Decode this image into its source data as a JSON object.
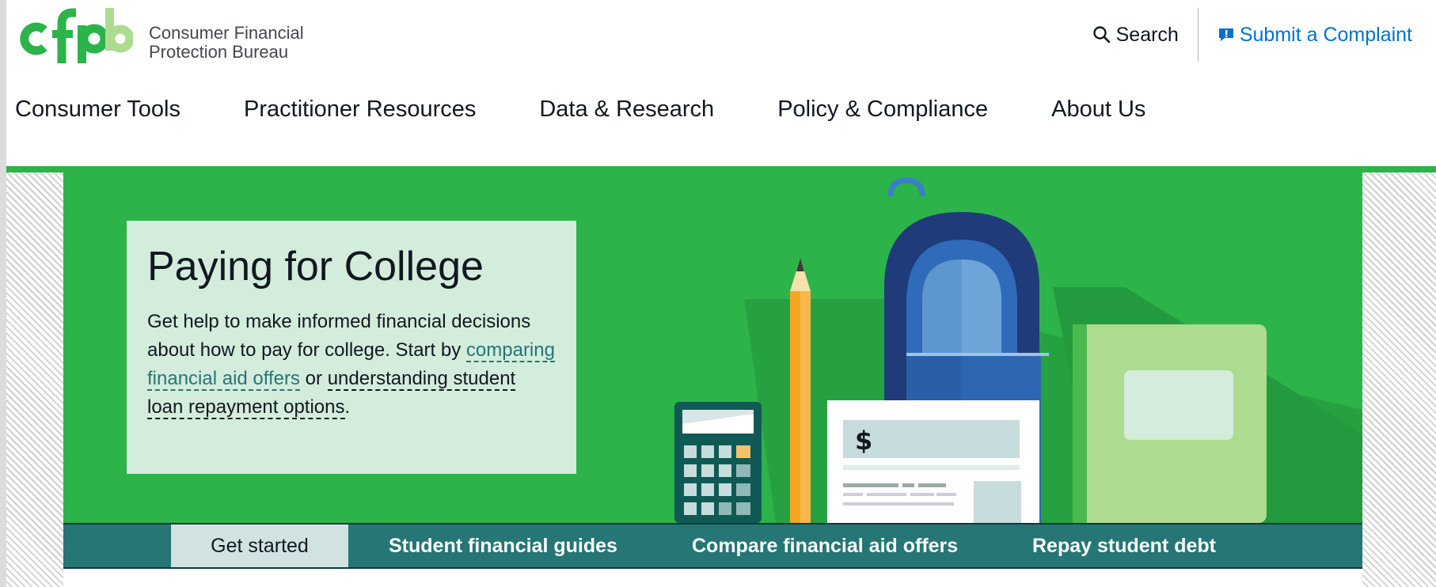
{
  "header": {
    "logo_text": "cfpb",
    "org_name_line1": "Consumer Financial",
    "org_name_line2": "Protection Bureau",
    "search_label": "Search",
    "complaint_label": "Submit a Complaint"
  },
  "nav": {
    "items": [
      {
        "label": "Consumer Tools"
      },
      {
        "label": "Practitioner Resources"
      },
      {
        "label": "Data & Research"
      },
      {
        "label": "Policy & Compliance"
      },
      {
        "label": "About Us"
      }
    ]
  },
  "hero": {
    "title": "Paying for College",
    "body_part1": "Get help to make informed financial decisions about how to pay for college. Start by ",
    "link1": "comparing financial aid offers",
    "body_part2": " or ",
    "link2": "understanding student loan repayment options",
    "body_part3": ".",
    "illustration_symbol": "$"
  },
  "tabs": [
    {
      "label": "Get started",
      "active": true
    },
    {
      "label": "Student financial guides",
      "active": false
    },
    {
      "label": "Compare financial aid offers",
      "active": false
    },
    {
      "label": "Repay student debt",
      "active": false
    }
  ],
  "colors": {
    "brand_green": "#2cb34a",
    "link_blue": "#0072ce",
    "teal": "#257675",
    "hero_card": "#d4ecdc"
  },
  "icons": {
    "search": "search-icon",
    "complaint": "complaint-icon"
  }
}
